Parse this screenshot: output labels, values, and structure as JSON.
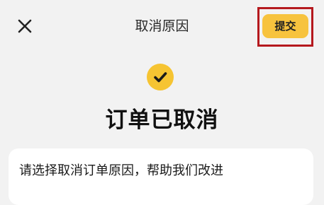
{
  "header": {
    "title": "取消原因",
    "close_icon": "close-icon",
    "submit_label": "提交"
  },
  "status": {
    "icon": "check-icon",
    "icon_color": "#f6c432",
    "title": "订单已取消"
  },
  "reason_card": {
    "prompt": "请选择取消订单原因，帮助我们改进"
  },
  "colors": {
    "accent": "#f7c33e",
    "highlight_border": "#b5191e",
    "background": "#f2f2f2",
    "card": "#ffffff"
  }
}
